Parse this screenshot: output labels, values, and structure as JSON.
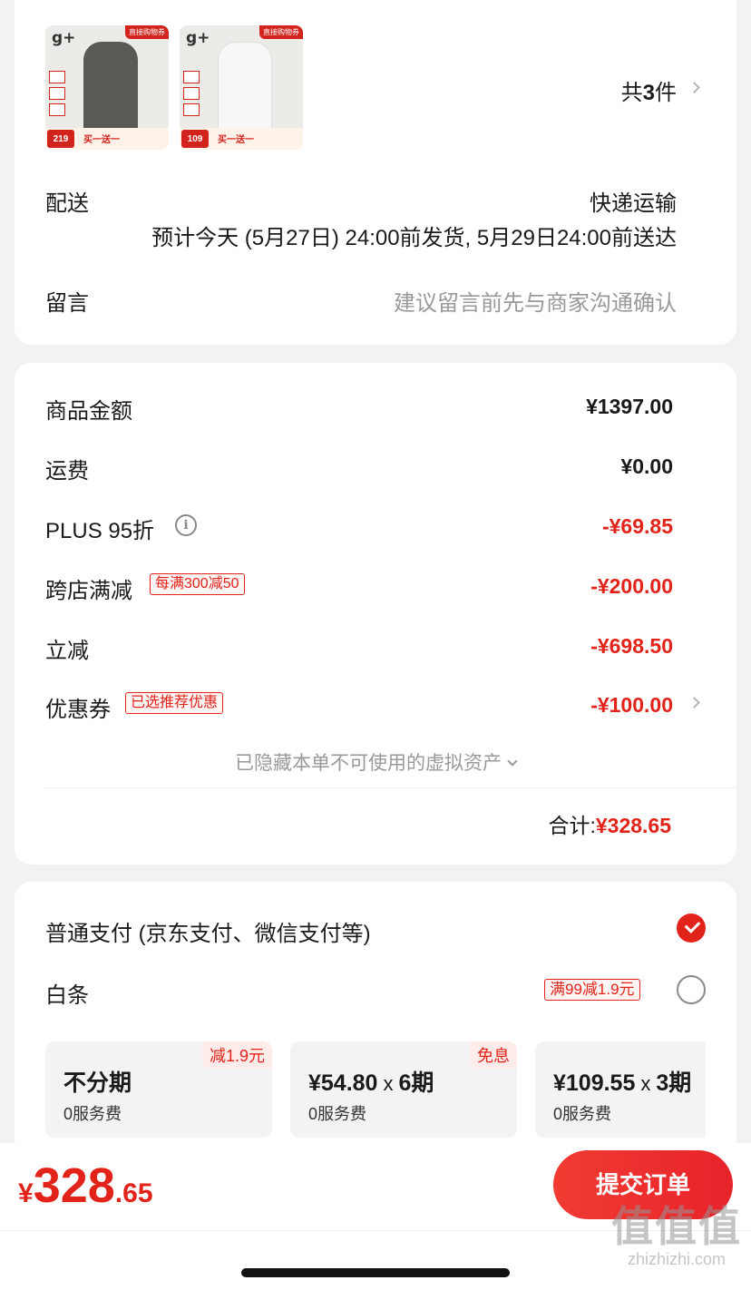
{
  "products": {
    "items": [
      {
        "logo": "g+",
        "corner": "直接购物券",
        "price": "219",
        "promo": "买一送一",
        "colors": {
          "top": "#f0eee9",
          "figure": "#5a5a55"
        }
      },
      {
        "logo": "g+",
        "corner": "直接购物券",
        "price": "109",
        "promo": "买一送一",
        "colors": {
          "top": "#eceae6",
          "figure": "#f5f5f5"
        }
      }
    ],
    "count_prefix": "共",
    "count_number": "3",
    "count_suffix": "件"
  },
  "delivery": {
    "label": "配送",
    "method": "快递运输",
    "estimate": "预计今天 (5月27日) 24:00前发货, 5月29日24:00前送达"
  },
  "message": {
    "label": "留言",
    "placeholder": "建议留言前先与商家沟通确认"
  },
  "price_breakdown": {
    "rows": [
      {
        "label": "商品金额",
        "value": "¥1397.00"
      },
      {
        "label": "运费",
        "value": "¥0.00"
      },
      {
        "label": "PLUS 95折",
        "value": "-¥69.85"
      },
      {
        "label": "跨店满减",
        "tag": "每满300减50",
        "value": "-¥200.00"
      },
      {
        "label": "立减",
        "value": "-¥698.50"
      },
      {
        "label": "优惠券",
        "tag": "已选推荐优惠",
        "value": "-¥100.00"
      }
    ],
    "hidden_assets": "已隐藏本单不可使用的虚拟资产",
    "subtotal_label": "合计:",
    "subtotal_value": "¥328.65"
  },
  "payment": {
    "normal_label": "普通支付 (京东支付、微信支付等)",
    "baitiao_label": "白条",
    "baitiao_tag": "满99减1.9元",
    "plans": [
      {
        "badge": "减1.9元",
        "title": "不分期",
        "amount": "",
        "x": "",
        "periods": "",
        "sub": "0服务费"
      },
      {
        "badge": "免息",
        "title": "",
        "amount": "¥54.80",
        "x": "x",
        "periods": "6期",
        "sub": "0服务费"
      },
      {
        "badge": "",
        "title": "",
        "amount": "¥109.55",
        "x": "x",
        "periods": "3期",
        "sub": "0服务费"
      }
    ]
  },
  "footer": {
    "total_currency": "¥",
    "total_int": "328",
    "total_dec": ".65",
    "submit_label": "提交订单",
    "watermark_main": "值值值",
    "watermark_sub": "zhizhizhi.com"
  },
  "colors": {
    "accent": "#e2231a",
    "background": "#f2f2f2",
    "card": "#ffffff",
    "muted_text": "#999999"
  }
}
